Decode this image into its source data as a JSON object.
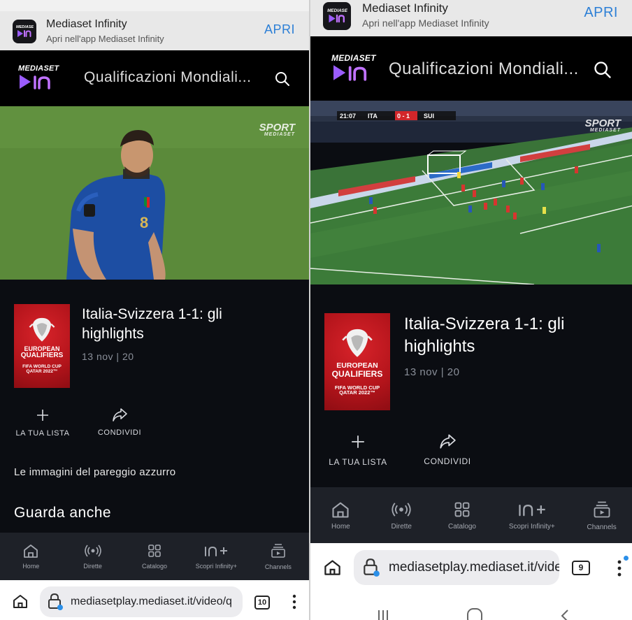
{
  "app_banner": {
    "app_name": "Mediaset Infinity",
    "subtitle": "Apri nell'app Mediaset Infinity",
    "open_label": "APRI"
  },
  "logo": {
    "top_text": "MEDIASET"
  },
  "header": {
    "title": "Qualificazioni Mondiali..."
  },
  "video_overlay": {
    "watermark_top": "SPORT",
    "watermark_bottom": "MEDIASET",
    "scoreboard": {
      "time": "21:07",
      "home": "ITA",
      "score": "0 - 1",
      "away": "SUI"
    }
  },
  "poster": {
    "line1": "EUROPEAN",
    "line2": "QUALIFIERS",
    "line3": "FIFA WORLD CUP",
    "line4": "QATAR 2022™"
  },
  "video_info": {
    "title": "Italia-Svizzera 1-1: gli highlights",
    "meta": "13 nov | 20"
  },
  "actions": {
    "add_list": "LA TUA LISTA",
    "share": "CONDIVIDI"
  },
  "description": "Le immagini del pareggio azzurro",
  "section_title": "Guarda anche",
  "bottom_nav": [
    {
      "label": "Home",
      "icon": "home-icon"
    },
    {
      "label": "Dirette",
      "icon": "live-icon"
    },
    {
      "label": "Catalogo",
      "icon": "catalog-icon"
    },
    {
      "label": "Scopri Infinity+",
      "icon": "infinity-plus-icon"
    },
    {
      "label": "Channels",
      "icon": "channels-icon"
    }
  ],
  "browser": {
    "url": "mediasetplay.mediaset.it/video/q",
    "tabs_left": "10",
    "tabs_right": "9"
  },
  "colors": {
    "accent_blue": "#2c7fd6",
    "brand_purple": "#8a4dff",
    "page_dark": "#0b0d12",
    "nav_bg": "#1e2128"
  }
}
